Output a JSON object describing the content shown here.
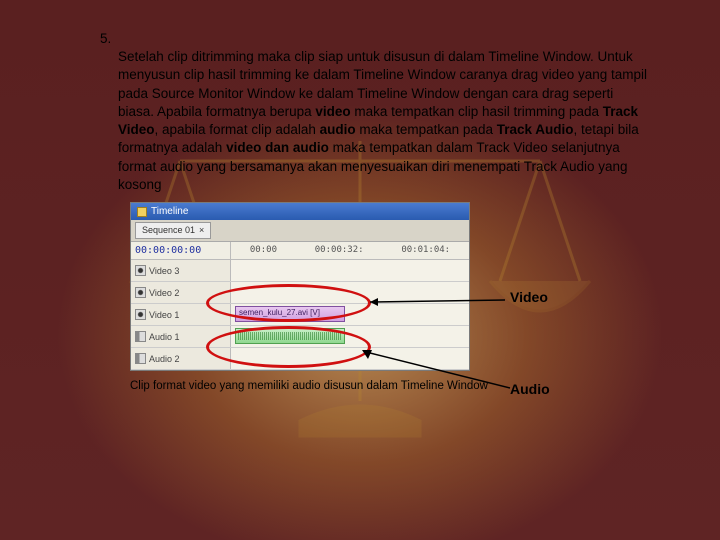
{
  "step_number": "5.",
  "paragraph_parts": {
    "p1": "Setelah clip ditrimming maka clip siap untuk disusun di dalam Timeline Window. Untuk menyusun clip hasil trimming ke dalam Timeline Window caranya drag video yang tampil pada Source Monitor Window ke dalam Timeline Window dengan cara drag seperti biasa. Apabila formatnya berupa ",
    "b1": "video",
    "p2": " maka tempatkan clip hasil trimming pada ",
    "b2": "Track Video",
    "p3": ", apabila format clip adalah ",
    "b3": "audio",
    "p4": " maka tempatkan pada    ",
    "b4": "Track Audio",
    "p5": ", tetapi bila formatnya  adalah ",
    "b5": "video dan audio",
    "p6": " maka tempatkan dalam Track Video selanjutnya format audio yang bersamanya akan menyesuaikan diri menempati Track Audio yang  kosong"
  },
  "timeline": {
    "title": "Timeline",
    "tab": "Sequence 01",
    "timecode": "00:00:00:00",
    "ruler": [
      "00:00",
      "00:00:32:",
      "00:01:04:"
    ],
    "tracks": {
      "v3": "Video 3",
      "v2": "Video 2",
      "v1": "Video 1",
      "a1": "Audio 1",
      "a2": "Audio 2"
    },
    "clip_name": "semen_kulu_27.avi [V]"
  },
  "labels": {
    "video": "Video",
    "audio": "Audio"
  },
  "caption": "Clip format video yang memiliki audio disusun dalam Timeline Window"
}
